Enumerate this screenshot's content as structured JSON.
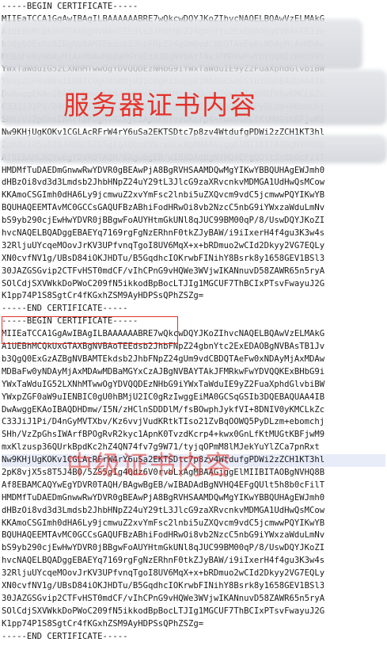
{
  "lines": [
    "-----BEGIN CERTIFICATE-----",
    "MIIEaTCCA1GgAwIBAgILBAAAAAABRE7wQkcwDQYJKoZIhvcNAQELBQAwVzELMAkG",
    "A1UEBhMCQkUxGTAXBgNVBAoTEEdsb2JhbFNpZ24gbnYtc2ExEDAOBgNVBAsTB1Jv",
    "b3QgQ0ExGzAZBgNVBAMTEkdsb2JhbFNpZ24gUm9vdCBDQTAeFw0xNDAyMjAxMDAw",
    "MDBaFw0yNDAyMjAxMDAwMDBaMGYxCzAJBgNVBAYTAkJFMRkwFwYDVQQKExBHbG9i",
    "YWxTaWduIG52LXNhMTwwOgYDVQQDEzNHbG9iYWxTaWduIE9yZ2FuaXphdGlvbiBW",
    "YWxpZGF0aW9uIENBIC0gU0hBMjU2IC0gRzIwggEiMA0GCSqGSIb3DQEBAQUAA4IB",
    "DwAwggEKAoIBAQDHDmw/I5N/zHClnSDDDlM/fsBOwphJykfVI+8DNIV0yKMCLkZc",
    "C33JiJ1Pi/D4nGyMVTXbv/Kz6vvjVudKRtkTIso21ZvBqOOWQ5PyDLzm+ebomchj",
    "SHh/VzZpGhsIWArfBPOgRvR2kyc1ApnK0TvzdKcrp4+kwx0GnLfKtMUGtKBFjwM9",
    "Nw9KHjUgKOKv1CGLAcRFrW4rY6uSa2EKTSDtc7p8zv4WtdufgPDWi2zZCH1KT3hl",
    "2pK8vjX5s8T5J4BO/5ZS5gIg4Qdz6V0rvbLxAgMBAAGjggElMIIBITAOBgNVHQ8B",
    "Af8EBAMCAQYwEgYDVR0TAQH/BAgwBgEB/wIBADAdBgNVHQ4EFgQUlt5h8b0cFilT",
    "HMDMfTuDAEDmGnwwRwYDVR0gBEAwPjA8BgRVHSAAMDQwMgYIKwYBBQUHAgEWJmh0",
    "dHBzOi8vd3d3Lmdsb2JhbHNpZ24uY29tL3JlcG9zaXRvcnkvMDMGA1UdHwQsMCow",
    "KKAmoCSGImh0dHA6Ly9jcmwuZ2xvYmFsc2lnbi5uZXQvcm9vdC5jcmwwPQYIKwYB",
    "BQUHAQEEMTAvMC0GCCsGAQUFBzABhiFodHRwOi8vb2NzcC5nbG9iYWxzaWduLmNv",
    "bS9yb290cjEwHwYDVR0jBBgwFoAUYHtmGkUNl8qJUC99BM00qP/8/UswDQYJKoZI",
    "hvcNAQELBQADggEBAEYq7169rgFgNzERhnF0tkZJyBAW/i9iIxerH4f4gu3K3w4s",
    "32RljuUYcqeMOovJrKV3UPfvnqTgoI8UV6MqX+x+bRDmuo2wCId2Dkyy2VG7EQLy",
    "XN0cvfNV1g/UBsD84iOKJHDTu/B5GqdhcIOKrwbFINihY8Bsrk8y1658GEV1BSl3",
    "30JAZGSGvip2CTFvHST0mdCF/vIhCPnG9vHQWe3WVjwIKANnuvD58ZAWR65n5ryA",
    "SOlCdjSXVWkkDoPWoC209fN5ikkodBpBocLTJIg1MGCUF7ThBCIxPTsvFwayuJ2G",
    "K1pp74P1S8SgtCr4fKGxhZSM9AyHDPSsQPhZSZg=",
    "-----END CERTIFICATE-----",
    "-----BEGIN CERTIFICATE-----",
    "MIIEaTCCA1GgAwIBAgILBAAAAAABRE7wQkcwDQYJKoZIhvcNAQELBQAwVzELMAkG",
    "A1UEBhMCQkUxGTAXBgNVBAoTEEdsb2JhbFNpZ24gbnYtc2ExEDAOBgNVBAsTB1Jv",
    "b3QgQ0ExGzAZBgNVBAMTEkdsb2JhbFNpZ24gUm9vdCBDQTAeFw0xNDAyMjAxMDAw",
    "MDBaFw0yNDAyMjAxMDAwMDBaMGYxCzAJBgNVBAYTAkJFMRkwFwYDVQQKExBHbG9i",
    "YWxTaWduIG52LXNhMTwwOgYDVQQDEzNHbG9iYWxTaWduIE9yZ2FuaXphdGlvbiBW",
    "YWxpZGF0aW9uIENBIC0gU0hBMjU2IC0gRzIwggEiMA0GCSqGSIb3DQEBAQUAA4IB",
    "DwAwggEKAoIBAQDHDmw/I5N/zHClnSDDDlM/fsBOwphJykfVI+8DNIV0yKMCLkZc",
    "C33JiJ1Pi/D4nGyMVTXbv/Kz6vvjVudKRtkTIso21ZvBqOOWQ5PyDLzm+ebomchj",
    "SHh/VzZpGhsIWArfBPOgRvR2kyc1ApnK0TvzdKcrp4+kwx0GnLfKtMUGtKBFjwM9",
    "mxKlzusp36QUrkBpdKc2hZ4QN74fv7g9W71/tyjqOPmM8lMJekYuYlZCa7pnRxt",
    "Nw9KHjUgKOKv1CGLAcRFrW4rY6uSa2EKTSDtc7p8zv4WtdufgPDWi2zZCH1KT3hl",
    "2pK8vjX5s8T5J4BO/5ZS5gIg4Qdz6V0rvbLxAgMBAAGjggElMIIBITAOBgNVHQ8B",
    "Af8EBAMCAQYwEgYDVR0TAQH/BAgwBgEB/wIBADAdBgNVHQ4EFgQUlt5h8b0cFilT",
    "HMDMfTuDAEDmGnwwRwYDVR0gBEAwPjA8BgRVHSAAMDQwMgYIKwYBBQUHAgEWJmh0",
    "dHBzOi8vd3d3Lmdsb2JhbHNpZ24uY29tL3JlcG9zaXRvcnkvMDMGA1UdHwQsMCow",
    "KKAmoCSGImh0dHA6Ly9jcmwuZ2xvYmFsc2lnbi5uZXQvcm9vdC5jcmwwPQYIKwYB",
    "BQUHAQEEMTAvMC0GCCsGAQUFBzABhiFodHRwOi8vb2NzcC5nbG9iYWxzaWduLmNv",
    "bS9yb290cjEwHwYDVR0jBBgwFoAUYHtmGkUNl8qJUC99BM00qP/8/UswDQYJKoZI",
    "hvcNAQELBQADggEBAEYq7169rgFgNzERhnF0tkZJyBAW/i9iIxerH4f4gu3K3w4s",
    "32RljuUYcqeMOovJrKV3UPfvnqTgoI8UV6MqX+x+bRDmuo2wCId2Dkyy2VG7EQLy",
    "XN0cvfNV1g/UBsD84iOKJHDTu/B5GqdhcIOKrwbFINihY8Bsrk8y1658GEV1BSl3",
    "30JAZGSGvip2CTFvHST0mdCF/vIhCPnG9vHQWe3WVjwIKANnuvD58ZAWR65n5ryA",
    "SOlCdjSXVWkkDoPWoC209fN5ikkodBpBocLTJIg1MGCUF7ThBCIxPTsvFwayuJ2G",
    "K1pp74P1S8SgtCr4fKGxhZSM9AyHDPSsQPhZSZg=",
    "-----END CERTIFICATE-----"
  ],
  "highlighted_line_index": 36,
  "labels": {
    "server_cert": "服务器证书内容",
    "intermediate_cert": "中级证书内容"
  },
  "colors": {
    "label": "#e4312a",
    "highlight": "#e8ecf9"
  }
}
